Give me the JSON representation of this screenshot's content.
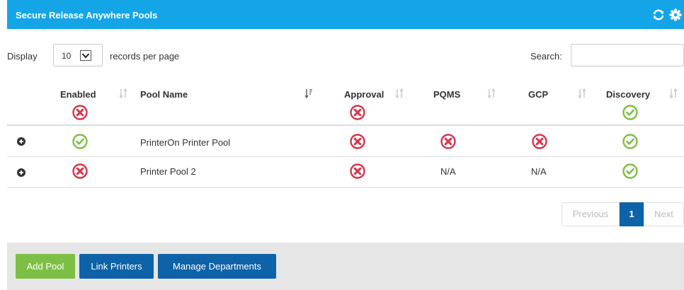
{
  "header": {
    "title": "Secure Release Anywhere Pools",
    "icons": [
      "refresh-icon",
      "gear-icon"
    ]
  },
  "controls": {
    "display_label": "Display",
    "page_size": "10",
    "records_label": "records per page",
    "search_label": "Search:",
    "search_value": ""
  },
  "table": {
    "columns": {
      "enabled": "Enabled",
      "pool_name": "Pool Name",
      "approval": "Approval",
      "pqms": "PQMS",
      "gcp": "GCP",
      "discovery": "Discovery"
    },
    "header_status": {
      "enabled": "disabled",
      "approval": "disabled",
      "discovery": "enabled"
    },
    "rows": [
      {
        "enabled": "enabled",
        "pool_name": "PrinterOn Printer Pool",
        "approval": "disabled",
        "pqms": "disabled",
        "gcp": "disabled",
        "discovery": "enabled"
      },
      {
        "enabled": "disabled",
        "pool_name": "Printer Pool 2",
        "approval": "disabled",
        "pqms": "N/A",
        "gcp": "N/A",
        "discovery": "enabled"
      }
    ]
  },
  "pagination": {
    "previous": "Previous",
    "current": "1",
    "next": "Next"
  },
  "footer": {
    "add_pool": "Add Pool",
    "link_printers": "Link Printers",
    "manage_departments": "Manage Departments"
  },
  "colors": {
    "header_bg": "#14a5e6",
    "enabled": "#7dbf45",
    "disabled": "#d9334a",
    "primary": "#0d62a8",
    "success": "#7dbf45",
    "footer_bg": "#e6e6e6"
  }
}
